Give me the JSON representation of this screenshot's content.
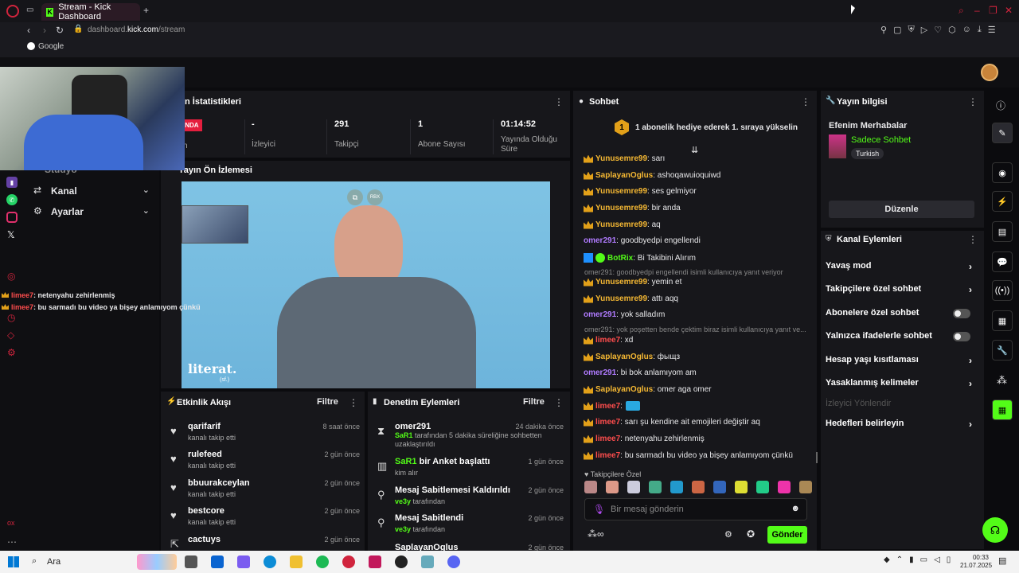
{
  "browser": {
    "tab_title": "Stream - Kick Dashboard",
    "new_tab": "+",
    "url_domain": "dashboard.",
    "url_host": "kick.com",
    "url_path": "/stream",
    "bookmark": "Google"
  },
  "stats": {
    "title": "Yayın İstatistikleri",
    "live_badge": "INDA",
    "live_sub": "n",
    "items": [
      {
        "value": "-",
        "label": "İzleyici"
      },
      {
        "value": "291",
        "label": "Takipçi"
      },
      {
        "value": "1",
        "label": "Abone Sayısı"
      },
      {
        "value": "01:14:52",
        "label": "Yayında Olduğu Süre"
      }
    ]
  },
  "preview": {
    "title": "Yayın Ön İzlemesi",
    "watermark": "literat.",
    "watermark_sub": "(sf.)",
    "rbx": "RBX"
  },
  "sidebar": {
    "partial_item": "Stüdyo",
    "items": [
      {
        "label": "Kanal"
      },
      {
        "label": "Ayarlar"
      }
    ]
  },
  "overlay_chat": [
    {
      "user": "limee7",
      "text": ": netenyahu zehirlenmiş"
    },
    {
      "user": "limee7",
      "text": ": bu sarmadı bu video ya bişey anlamıyom çünkü"
    }
  ],
  "activity": {
    "title": "Etkinlik Akışı",
    "filter": "Filtre",
    "items": [
      {
        "name": "qarifarif",
        "sub": "kanalı takip etti",
        "time": "8 saat önce"
      },
      {
        "name": "rulefeed",
        "sub": "kanalı takip etti",
        "time": "2 gün önce"
      },
      {
        "name": "bbuurakceylan",
        "sub": "kanalı takip etti",
        "time": "2 gün önce"
      },
      {
        "name": "bestcore",
        "sub": "kanalı takip etti",
        "time": "2 gün önce"
      },
      {
        "name": "cactuys",
        "sub": "",
        "time": "2 gün önce"
      }
    ]
  },
  "moderation": {
    "title": "Denetim Eylemleri",
    "filter": "Filtre",
    "items": [
      {
        "name": "omer291",
        "by": "SaR1",
        "sub": " tarafından 5 dakika süreliğine sohbetten",
        "sub2": "uzaklaştırıldı",
        "time": "24 dakika önce"
      },
      {
        "name": "bir Anket başlattı",
        "by_prefix": "SaR1",
        "sub": "kim alır",
        "time": "1 gün önce"
      },
      {
        "name": "Mesaj Sabitlemesi Kaldırıldı",
        "by": "ve3y",
        "sub": " tarafından",
        "time": "2 gün önce"
      },
      {
        "name": "Mesaj Sabitlendi",
        "by": "ve3y",
        "sub": " tarafından",
        "time": "2 gün önce"
      },
      {
        "name": "SaplayanOglus",
        "time": "2 gün önce"
      }
    ]
  },
  "chat": {
    "title": "Sohbet",
    "pinned": "1 abonelik hediye ederek 1. sıraya yükselin",
    "pinned_rank": "1",
    "messages": [
      {
        "user": "Yunusemre99",
        "text": ": sarı",
        "color": "y",
        "crown": true
      },
      {
        "user": "SaplayanOglus",
        "text": ": ashoqawuioquiwd",
        "color": "y",
        "crown": true
      },
      {
        "user": "Yunusemre99",
        "text": ": ses gelmiyor",
        "color": "y",
        "crown": true
      },
      {
        "user": "Yunusemre99",
        "text": ": bir anda",
        "color": "y",
        "crown": true
      },
      {
        "user": "Yunusemre99",
        "text": ": aq",
        "color": "y",
        "crown": true
      },
      {
        "user": "omer291",
        "text": ": goodbyedpi engellendi",
        "color": "p",
        "crown": false
      },
      {
        "user": "BotRix",
        "text": ": Bi Takibini Alırım",
        "color": "g",
        "crown": false
      },
      {
        "reply": "omer291: goodbyedpi engellendi isimli kullanıcıya yanıt veriyor"
      },
      {
        "user": "Yunusemre99",
        "text": ": yemin et",
        "color": "y",
        "crown": true
      },
      {
        "user": "Yunusemre99",
        "text": ": attı aqq",
        "color": "y",
        "crown": true
      },
      {
        "user": "omer291",
        "text": ": yok salladım",
        "color": "p",
        "crown": false
      },
      {
        "reply": "omer291: yok poşetten bende çektim biraz isimli kullanıcıya yanıt ve..."
      },
      {
        "user": "limee7",
        "text": ": xd",
        "color": "r",
        "crown": true
      },
      {
        "user": "SaplayanOglus",
        "text": ": фыщз",
        "color": "y",
        "crown": true
      },
      {
        "user": "omer291",
        "text": ": bi bok anlamıyom am",
        "color": "p",
        "crown": false
      },
      {
        "user": "SaplayanOglus",
        "text": ": omer aga omer",
        "color": "y",
        "crown": true
      },
      {
        "user": "limee7",
        "text": ":",
        "color": "r",
        "crown": true
      },
      {
        "user": "limee7",
        "text": ": sarı şu kendine ait emojileri değiştir aq",
        "color": "r",
        "crown": true
      },
      {
        "user": "limee7",
        "text": ": netenyahu zehirlenmiş",
        "color": "r",
        "crown": true
      },
      {
        "user": "limee7",
        "text": ": bu sarmadı bu video ya bişey anlamıyom çünkü",
        "color": "r",
        "crown": true
      }
    ],
    "followers_only": "Takipçilere Özel",
    "placeholder": "Bir mesaj gönderin",
    "send": "Gönder"
  },
  "stream_info": {
    "title": "Yayın bilgisi",
    "stream_title": "Efenim Merhabalar",
    "category": "Sadece Sohbet",
    "language": "Turkish",
    "edit": "Düzenle"
  },
  "channel_actions": {
    "title": "Kanal Eylemleri",
    "items": [
      {
        "label": "Yavaş mod",
        "kind": "chev"
      },
      {
        "label": "Takipçilere özel sohbet",
        "kind": "chev"
      },
      {
        "label": "Abonelere özel sohbet",
        "kind": "toggle"
      },
      {
        "label": "Yalnızca ifadelerle sohbet",
        "kind": "toggle"
      },
      {
        "label": "Hesap yaşı kısıtlaması",
        "kind": "chev"
      },
      {
        "label": "Yasaklanmış kelimeler",
        "kind": "chev"
      },
      {
        "label": "İzleyici Yönlendir",
        "kind": "disabled"
      },
      {
        "label": "Hedefleri belirleyin",
        "kind": "chev"
      }
    ]
  },
  "taskbar": {
    "search": "Ara",
    "time": "00:33",
    "date": "21.07.2025"
  },
  "colors": {
    "kick_green": "#53fc18",
    "panel": "#17171b",
    "bg": "#0b0b0e"
  }
}
